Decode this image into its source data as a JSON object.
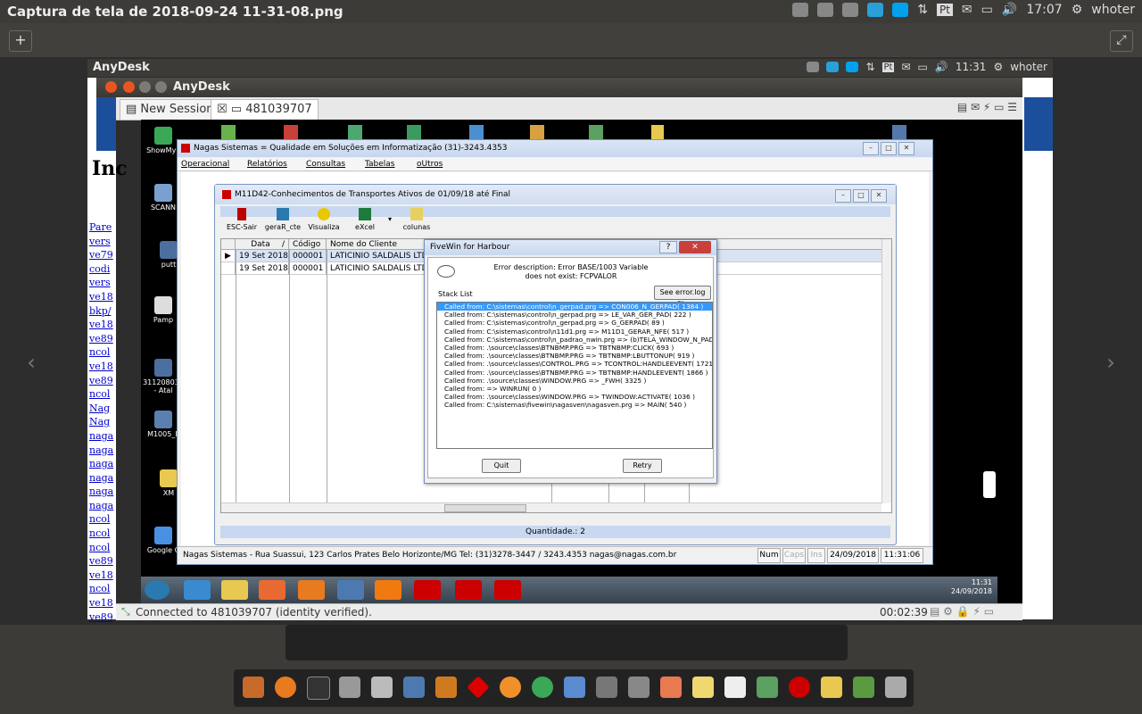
{
  "outer": {
    "title": "Captura de tela de 2018-09-24 11-31-08.png",
    "tray_lang": "Pt",
    "clock": "17:07",
    "user": "whoter"
  },
  "inner_panel": {
    "app": "AnyDesk",
    "tray_lang": "Pt",
    "clock": "11:31",
    "user": "whoter"
  },
  "anydesk": {
    "title": "AnyDesk",
    "new_session": "New Session",
    "session_id": "481039707",
    "status": "Connected to 481039707 (identity verified).",
    "timer": "00:02:39"
  },
  "browser_bg": {
    "heading": "Inc",
    "links": [
      "Pare",
      "vers",
      "ve79",
      "codi",
      "vers",
      "ve18",
      "bkp/",
      "ve18",
      "ve89",
      "ncol",
      "ve18",
      "ve89",
      "ncol",
      "Nag",
      "Nag",
      "naga",
      "naga",
      "naga",
      "naga",
      "naga",
      "naga",
      "ncol",
      "ncol",
      "ncol",
      "ve89",
      "ve18",
      "ncol",
      "ve18",
      "ve89"
    ]
  },
  "desktop_icons": [
    "ShowMyF",
    "SCANN",
    "putt",
    "Pamp",
    "311208030 - Atal",
    "M1005_F",
    "XM",
    "Google C"
  ],
  "nagas": {
    "title": "Nagas Sistemas = Qualidade em Soluções em Informatização  (31)-3243.4353",
    "menu": [
      "Operacional",
      "Relatórios",
      "Consultas",
      "Tabelas",
      "oUtros"
    ],
    "status": {
      "address": "Nagas Sistemas - Rua Suassui, 123 Carlos Prates Belo Horizonte/MG Tel: (31)3278-3447 / 3243.4353  nagas@nagas.com.br",
      "num": "Num",
      "caps": "Caps",
      "ins": "Ins",
      "date": "24/09/2018",
      "time": "11:31:06"
    }
  },
  "child": {
    "title": "M11D42-Conhecimentos de Transportes Ativos de 01/09/18 até Final",
    "toolbar": [
      "ESC-Sair",
      "geraR_cte",
      "Visualiza",
      "eXcel",
      "colunas"
    ],
    "columns": [
      "Data",
      "Código",
      "Nome do Cliente"
    ],
    "rows": [
      [
        "19 Set 2018",
        "000001",
        "LATICINIO SALDALIS LTDA"
      ],
      [
        "19 Set 2018",
        "000001",
        "LATICINIO SALDALIS LTDA"
      ]
    ],
    "quantity": "Quantidade.: 2"
  },
  "error": {
    "title": "FiveWin for Harbour",
    "help": "?",
    "desc_line1": "Error description: Error BASE/1003  Variable",
    "desc_line2": "does not exist: FCPVALOR",
    "stack_label": "Stack List",
    "see_log": "See error.log file",
    "stack": [
      "Called from: C:\\sistemas\\control\\n_gerpad.prg => CON006_N_GERPAD( 1384 )",
      "Called from: C:\\sistemas\\control\\n_gerpad.prg => LE_VAR_GER_PAD( 222 )",
      "Called from: C:\\sistemas\\control\\n_gerpad.prg => G_GERPAD( 89 )",
      "Called from: C:\\sistemas\\control\\n11d1.prg => M11D1_GERAR_NFE( 517 )",
      "Called from: C:\\sistemas\\control\\n_padrao_nwin.prg => (b)TELA_WINDOW_N_PADRAO",
      "Called from: .\\source\\classes\\BTNBMP.PRG => TBTNBMP:CLICK( 693 )",
      "Called from: .\\source\\classes\\BTNBMP.PRG => TBTNBMP:LBUTTONUP( 919 )",
      "Called from: .\\source\\classes\\CONTROL.PRG => TCONTROL:HANDLEEVENT( 1721 )",
      "Called from: .\\source\\classes\\BTNBMP.PRG => TBTNBMP:HANDLEEVENT( 1866 )",
      "Called from: .\\source\\classes\\WINDOW.PRG => _FWH( 3325 )",
      "Called from:  => WINRUN( 0 )",
      "Called from: .\\source\\classes\\WINDOW.PRG => TWINDOW:ACTIVATE( 1036 )",
      "Called from: C:\\sistemas\\fivewin\\nagasven\\nagasven.prg => MAIN( 540 )"
    ],
    "quit": "Quit",
    "retry": "Retry"
  },
  "remote_taskbar": {
    "clock": "11:31",
    "date": "24/09/2018"
  },
  "colors": {
    "selection": "#3399ff",
    "anydesk_blue": "#1b4f9c",
    "close_red": "#c8403a"
  }
}
